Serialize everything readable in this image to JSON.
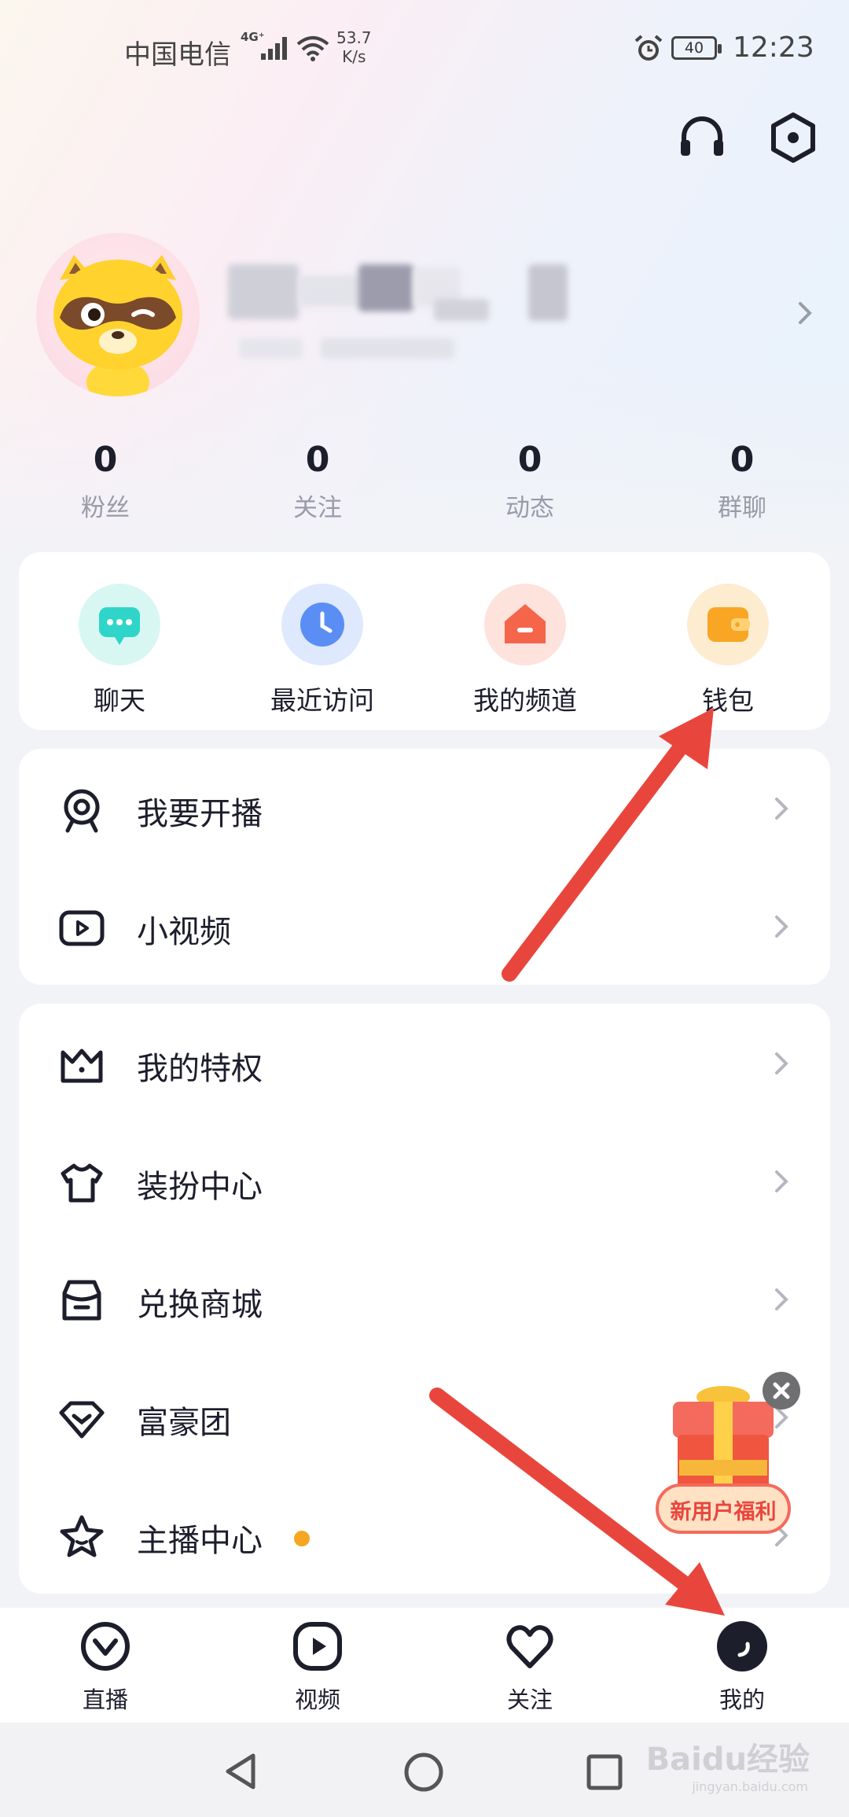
{
  "status_bar": {
    "carrier": "中国电信",
    "network": "4G⁺",
    "speed_value": "53.7",
    "speed_unit": "K/s",
    "battery": "40",
    "time": "12:23"
  },
  "stats": [
    {
      "value": "0",
      "label": "粉丝"
    },
    {
      "value": "0",
      "label": "关注"
    },
    {
      "value": "0",
      "label": "动态"
    },
    {
      "value": "0",
      "label": "群聊"
    }
  ],
  "quick_actions": [
    {
      "label": "聊天",
      "icon": "chat-bubble-icon",
      "color": "#2fd5c9"
    },
    {
      "label": "最近访问",
      "icon": "clock-icon",
      "color": "#5b8ef5"
    },
    {
      "label": "我的频道",
      "icon": "house-icon",
      "color": "#f5654a"
    },
    {
      "label": "钱包",
      "icon": "wallet-icon",
      "color": "#f8a623"
    }
  ],
  "menu_group_1": [
    {
      "label": "我要开播",
      "icon": "webcam-icon"
    },
    {
      "label": "小视频",
      "icon": "video-play-icon"
    }
  ],
  "menu_group_2": [
    {
      "label": "我的特权",
      "icon": "crown-icon"
    },
    {
      "label": "装扮中心",
      "icon": "tshirt-icon"
    },
    {
      "label": "兑换商城",
      "icon": "store-icon"
    },
    {
      "label": "富豪团",
      "icon": "diamond-icon"
    },
    {
      "label": "主播中心",
      "icon": "star-icon"
    }
  ],
  "promo": {
    "label": "新用户福利"
  },
  "tabs": [
    {
      "label": "直播",
      "icon": "live-icon"
    },
    {
      "label": "视频",
      "icon": "video-icon"
    },
    {
      "label": "关注",
      "icon": "heart-icon"
    },
    {
      "label": "我的",
      "icon": "profile-icon",
      "active": true
    }
  ],
  "watermark": {
    "brand": "Baidu经验",
    "url": "jingyan.baidu.com"
  },
  "colors": {
    "accent_dot": "#f5a623",
    "arrow": "#e8463d"
  }
}
